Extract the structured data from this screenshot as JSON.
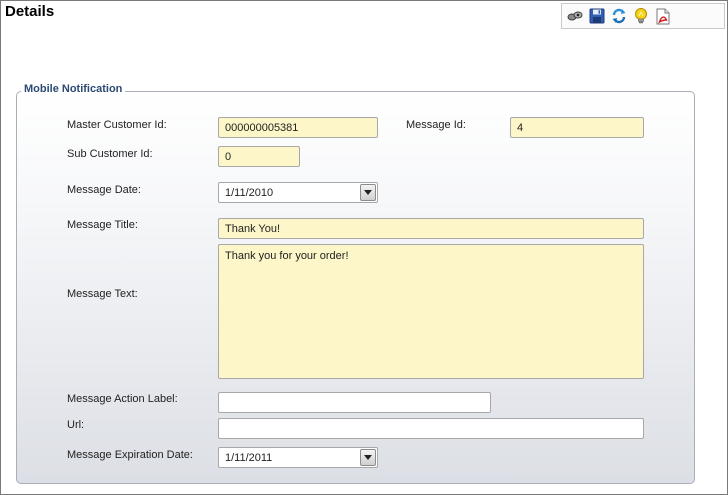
{
  "page": {
    "title": "Details"
  },
  "toolbar": {
    "buttons": [
      {
        "name": "view-icon"
      },
      {
        "name": "save-icon"
      },
      {
        "name": "refresh-icon"
      },
      {
        "name": "lightbulb-icon"
      },
      {
        "name": "pdf-icon"
      }
    ]
  },
  "section": {
    "legend": "Mobile Notification"
  },
  "form": {
    "master_customer_id": {
      "label": "Master Customer Id:",
      "value": "000000005381"
    },
    "message_id": {
      "label": "Message Id:",
      "value": "4"
    },
    "sub_customer_id": {
      "label": "Sub Customer Id:",
      "value": "0"
    },
    "message_date": {
      "label": "Message Date:",
      "value": "1/11/2010"
    },
    "message_title": {
      "label": "Message Title:",
      "value": "Thank You!"
    },
    "message_text": {
      "label": "Message Text:",
      "value": "Thank you for your order!"
    },
    "message_action_label": {
      "label": "Message Action Label:",
      "value": ""
    },
    "url": {
      "label": "Url:",
      "value": ""
    },
    "message_expiration_date": {
      "label": "Message Expiration Date:",
      "value": "1/11/2011"
    }
  },
  "colors": {
    "required_field_bg": "#fdf6c8",
    "legend_text": "#2c4a74",
    "border": "#a8a8a8"
  }
}
